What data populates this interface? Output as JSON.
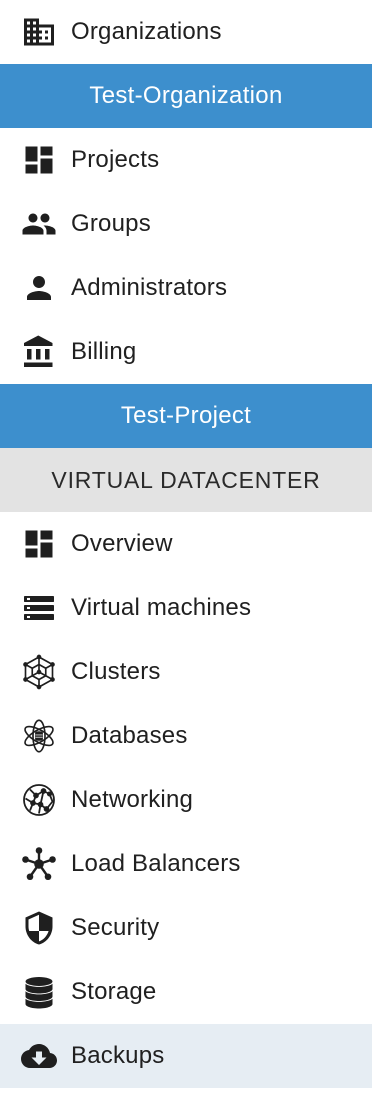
{
  "nav": {
    "organizations": {
      "label": "Organizations",
      "icon": "building-icon"
    },
    "organization_header": {
      "label": "Test-Organization"
    },
    "org_items": [
      {
        "label": "Projects",
        "icon": "dashboard-icon"
      },
      {
        "label": "Groups",
        "icon": "people-icon"
      },
      {
        "label": "Administrators",
        "icon": "person-icon"
      },
      {
        "label": "Billing",
        "icon": "bank-icon"
      }
    ],
    "project_header": {
      "label": "Test-Project"
    },
    "section_header": {
      "label": "VIRTUAL DATACENTER"
    },
    "project_items": [
      {
        "label": "Overview",
        "icon": "dashboard-icon"
      },
      {
        "label": "Virtual machines",
        "icon": "server-list-icon"
      },
      {
        "label": "Clusters",
        "icon": "cube-network-icon"
      },
      {
        "label": "Databases",
        "icon": "atom-database-icon"
      },
      {
        "label": "Networking",
        "icon": "network-globe-icon"
      },
      {
        "label": "Load Balancers",
        "icon": "hub-nodes-icon"
      },
      {
        "label": "Security",
        "icon": "shield-icon"
      },
      {
        "label": "Storage",
        "icon": "database-stack-icon"
      },
      {
        "label": "Backups",
        "icon": "cloud-download-icon",
        "active": true
      }
    ]
  },
  "colors": {
    "header_blue": "#3d8fcd",
    "section_gray": "#e3e3e3",
    "active_bg": "#e6edf3",
    "icon": "#1f1f1f"
  }
}
